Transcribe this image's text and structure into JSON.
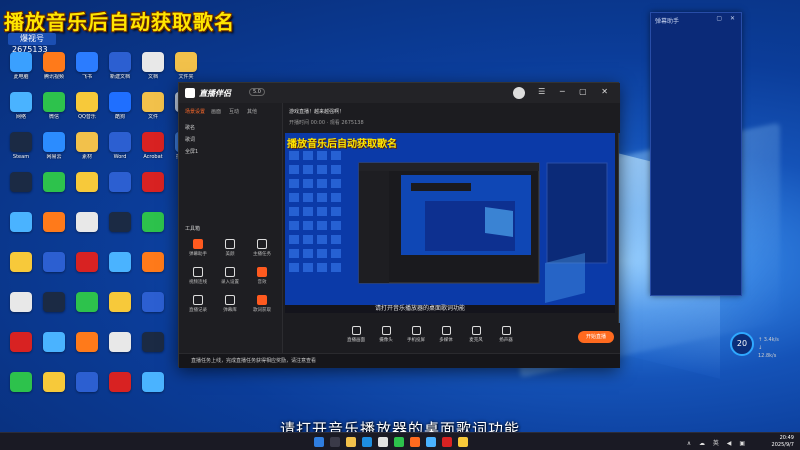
{
  "overlay": {
    "title": "播放音乐后自动获取歌名",
    "badge": "爆视号",
    "count": "2675133"
  },
  "desktop_icons": [
    {
      "label": "此电脑",
      "color": "#3aa0ff"
    },
    {
      "label": "腾讯视频",
      "color": "#ff7a1a"
    },
    {
      "label": "飞书",
      "color": "#2b7cff"
    },
    {
      "label": "新建文档",
      "color": "#2c5fd1"
    },
    {
      "label": "文档",
      "color": "#e8e8e8"
    },
    {
      "label": "文件夹",
      "color": "#f2c14b"
    },
    {
      "label": "网络",
      "color": "#4ab3ff"
    },
    {
      "label": "微信",
      "color": "#2dc24c"
    },
    {
      "label": "QQ音乐",
      "color": "#f7c93a"
    },
    {
      "label": "酷狗",
      "color": "#1f6fff"
    },
    {
      "label": "文件",
      "color": "#f2c14b"
    },
    {
      "label": "回收站",
      "color": "#c9d6e8"
    },
    {
      "label": "Steam",
      "color": "#1b2a44"
    },
    {
      "label": "网易云",
      "color": "#2b8cff"
    },
    {
      "label": "素材",
      "color": "#f2c14b"
    },
    {
      "label": "Word",
      "color": "#2c5fd1"
    },
    {
      "label": "Acrobat",
      "color": "#d82222"
    },
    {
      "label": "控制面板",
      "color": "#3f7fe0"
    }
  ],
  "widget": {
    "title": "弹幕助手",
    "ctrls": "▢ ✕"
  },
  "app": {
    "name": "直播伴侣",
    "version": "5.0",
    "window_controls": "☰ ─ ▢ ✕",
    "left_tabs": [
      {
        "label": "场景设置",
        "active": true
      },
      {
        "label": "画面"
      },
      {
        "label": "互动"
      },
      {
        "label": "其他"
      }
    ],
    "scenes": [
      {
        "label": "歌名"
      },
      {
        "label": "歌词"
      },
      {
        "label": "全屏1"
      }
    ],
    "tools_label": "工具箱",
    "tools": [
      {
        "label": "弹幕助手",
        "hot": true
      },
      {
        "label": "美颜"
      },
      {
        "label": "主播任务"
      },
      {
        "label": "视频连线"
      },
      {
        "label": "录入设置"
      },
      {
        "label": "音效",
        "hot": true
      },
      {
        "label": "直播记录"
      },
      {
        "label": "弹幕库"
      },
      {
        "label": "歌词获取",
        "hot": true
      }
    ],
    "stream_title": "游戏直播！越来越强啊！",
    "stream_meta": "开播时间 00:00 · 观看 2675138",
    "preview_title": "播放音乐后自动获取歌名",
    "preview_subtitle": "请打开音乐播放器的桌面歌词功能",
    "bottom_buttons": [
      {
        "label": "直播画面"
      },
      {
        "label": "摄像头"
      },
      {
        "label": "手机投屏"
      },
      {
        "label": "多媒体"
      },
      {
        "label": "麦克风"
      },
      {
        "label": "扬声器"
      }
    ],
    "go_live": "开始直播",
    "notice": "直播任务上线，完成直播任务获得相应奖励，请注意查看"
  },
  "subtitle": "请打开音乐播放器的桌面歌词功能",
  "perf": {
    "value": "20",
    "unit": "°c",
    "up": "↑ 3.4k/s",
    "down": "↓ 12.8k/s"
  },
  "tray": "∧ ☁ 英 ◀ ▣",
  "clock": {
    "time": "20:49",
    "date": "2025/9/7"
  }
}
